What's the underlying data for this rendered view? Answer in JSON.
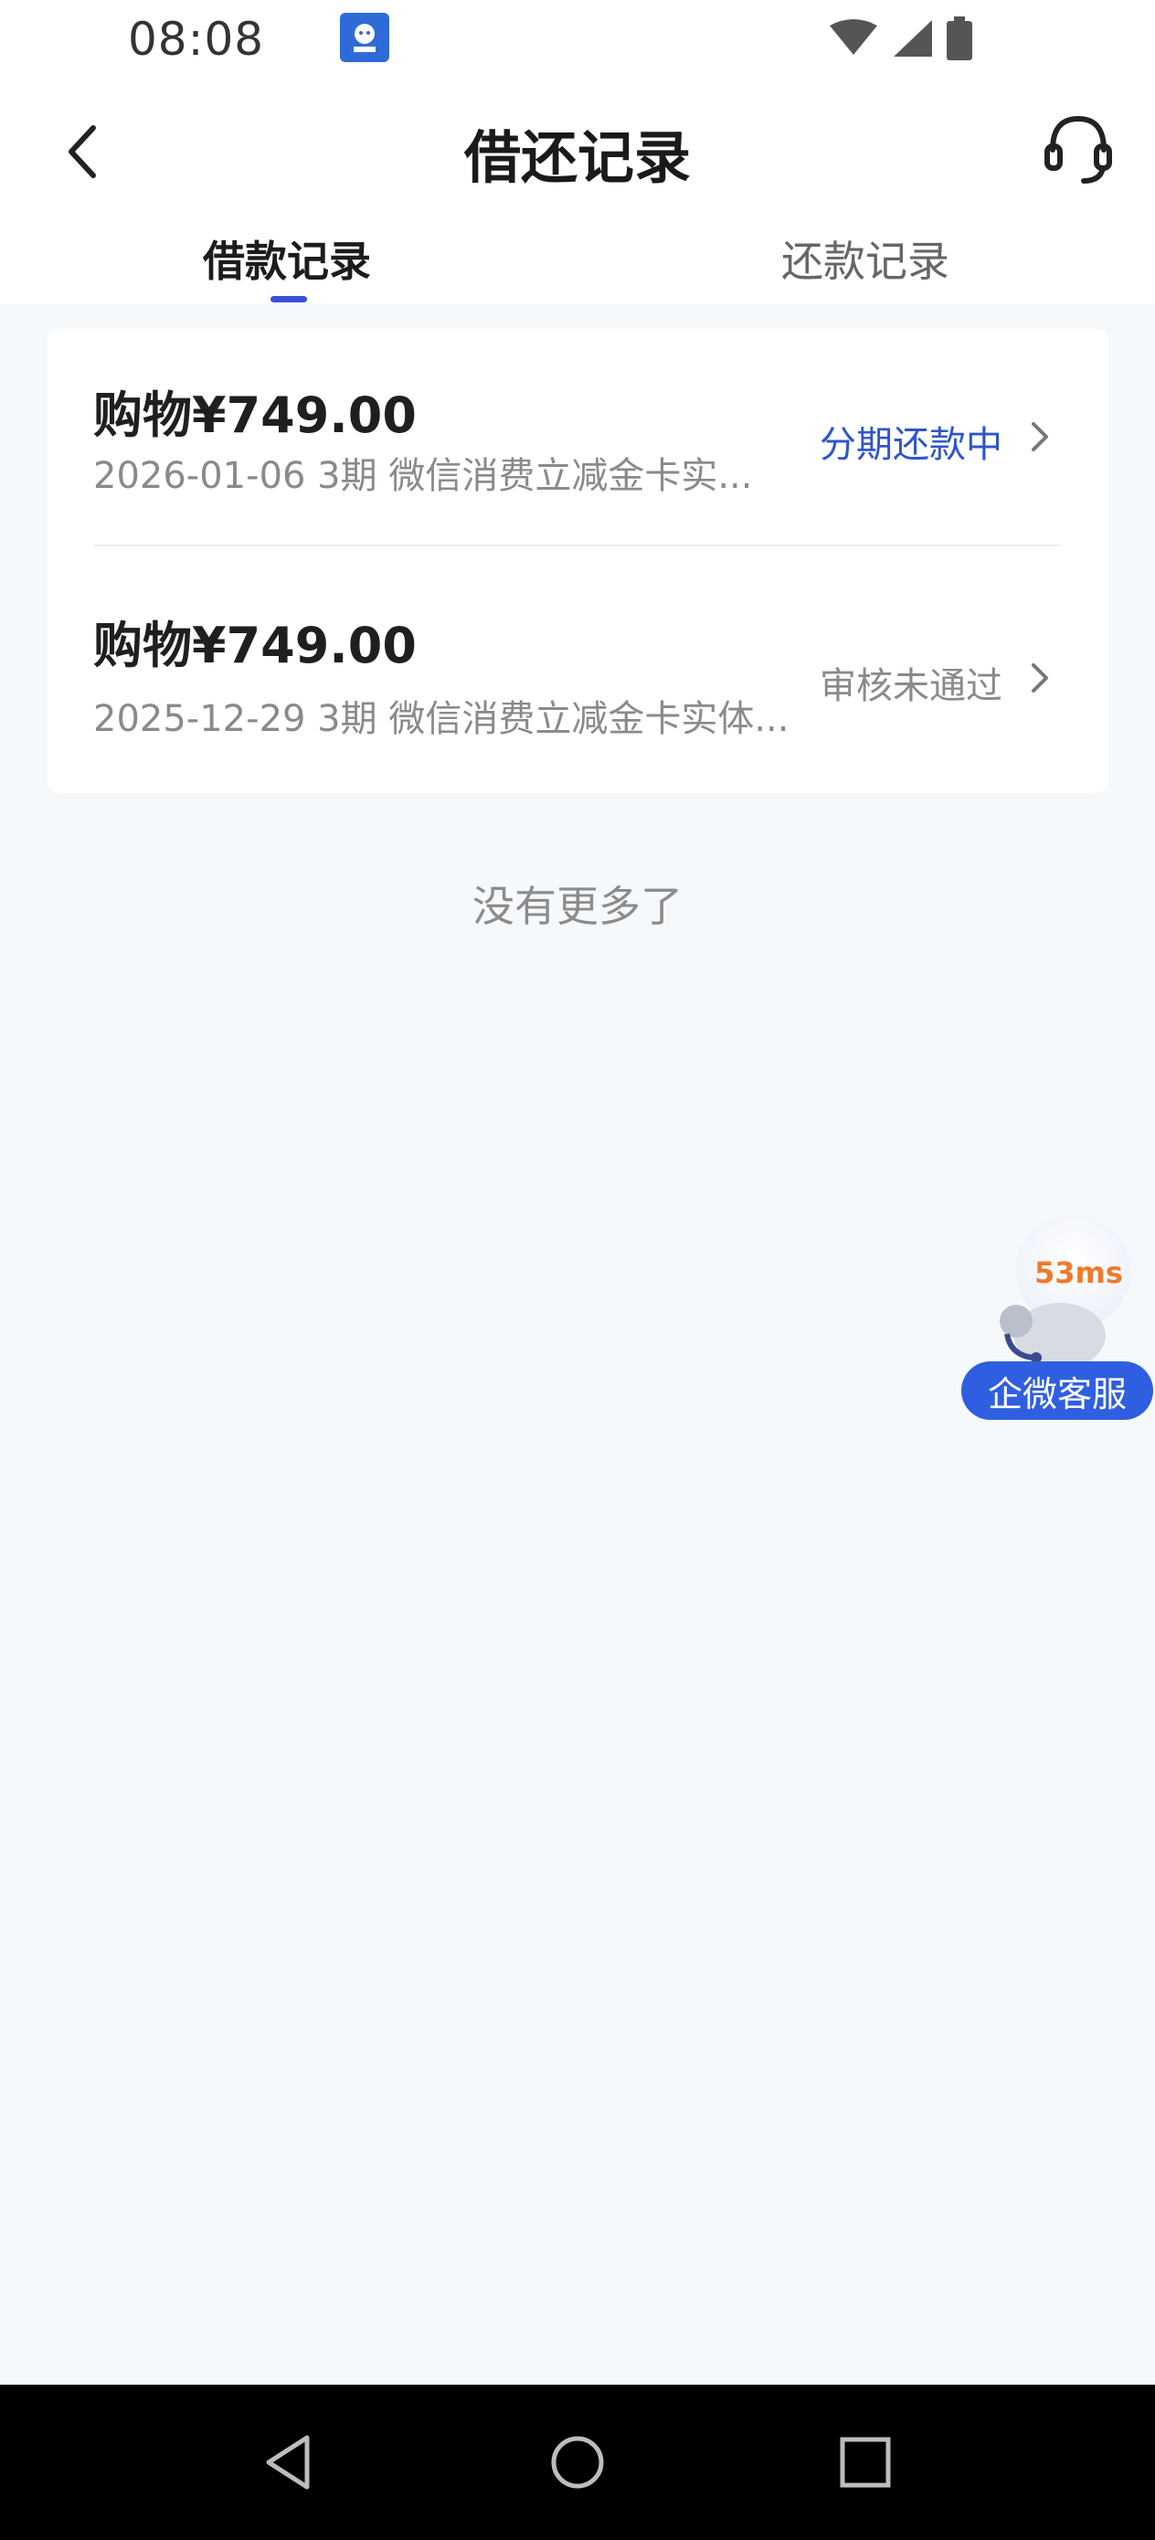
{
  "status_bar": {
    "time": "08:08"
  },
  "header": {
    "title": "借还记录"
  },
  "tabs": [
    {
      "label": "借款记录",
      "active": true
    },
    {
      "label": "还款记录",
      "active": false
    }
  ],
  "records": [
    {
      "amount": "购物¥749.00",
      "detail": "2026-01-06 3期  微信消费立减金卡实...",
      "status": "分期还款中"
    },
    {
      "amount": "购物¥749.00",
      "detail": "2025-12-29 3期  微信消费立减金卡实体...",
      "status": "审核未通过"
    }
  ],
  "footer_note": "没有更多了",
  "floating_support": {
    "badge": "53ms",
    "label": "企微客服"
  },
  "colors": {
    "accent": "#3a4fd6",
    "status_active": "#2f55cc",
    "status_rejected": "#8a8a8a",
    "background": "#f6f9fc",
    "pill": "#2f5fe0"
  }
}
